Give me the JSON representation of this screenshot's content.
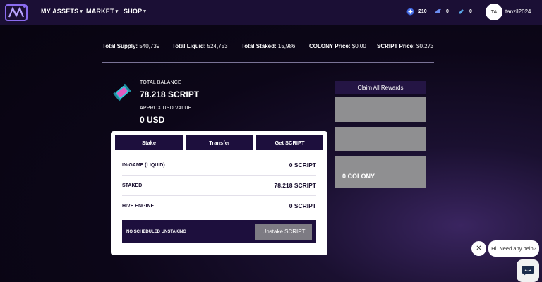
{
  "nav": {
    "items": [
      {
        "label": "MY ASSETS"
      },
      {
        "label": "MARKET"
      },
      {
        "label": "SHOP"
      }
    ],
    "counters": [
      {
        "icon": "plus-coin-icon",
        "value": "210"
      },
      {
        "icon": "wing-icon",
        "value": "0"
      },
      {
        "icon": "ticket-icon",
        "value": "0"
      }
    ],
    "avatar_initials": "TA",
    "username": "tanzil2024"
  },
  "stats": {
    "total_supply_label": "Total Supply:",
    "total_supply": "540,739",
    "total_liquid_label": "Total Liquid:",
    "total_liquid": "524,753",
    "total_staked_label": "Total Staked:",
    "total_staked": "15,986",
    "colony_price_label": "COLONY Price:",
    "colony_price": "$0.00",
    "script_price_label": "SCRIPT Price:",
    "script_price": "$0.273"
  },
  "balance": {
    "total_label": "TOTAL BALANCE",
    "total_value": "78.218 SCRIPT",
    "usd_label": "APPROX USD VALUE",
    "usd_value": "0 USD"
  },
  "panel": {
    "tabs": [
      {
        "label": "Stake"
      },
      {
        "label": "Transfer"
      },
      {
        "label": "Get SCRIPT"
      }
    ],
    "rows": [
      {
        "label": "IN-GAME (LIQUID)",
        "value": "0 SCRIPT"
      },
      {
        "label": "STAKED",
        "value": "78.218 SCRIPT"
      },
      {
        "label": "HIVE ENGINE",
        "value": "0 SCRIPT"
      }
    ],
    "unstaking_text": "NO SCHEDULED UNSTAKING",
    "unstake_button": "Unstake SCRIPT"
  },
  "rewards": {
    "claim_button": "Claim All Rewards",
    "colony_value": "0 COLONY"
  },
  "chat": {
    "bubble_text": "Hi. Need any help?"
  },
  "colors": {
    "nav_bg": "#1b0f35",
    "button_dark": "#1d0f3d",
    "reward_gray": "#8f8f91"
  }
}
